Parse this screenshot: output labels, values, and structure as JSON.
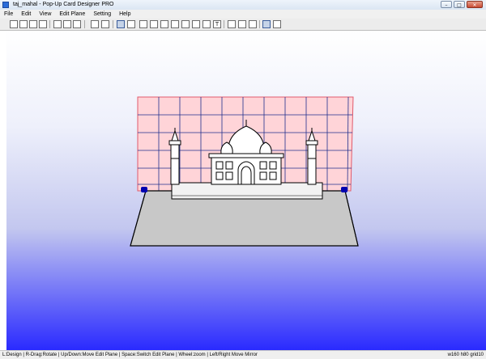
{
  "window": {
    "title": "taj_mahal - Pop-Up Card Designer PRO",
    "minimize_glyph": "–",
    "maximize_glyph": "□",
    "close_glyph": "✕"
  },
  "menu": [
    "File",
    "Edit",
    "View",
    "Edit Plane",
    "Setting",
    "Help"
  ],
  "toolbar": {
    "buttons": [
      "new-icon",
      "open-icon",
      "save-icon",
      "print-icon",
      "fit-icon",
      "cut-icon",
      "shape-icon",
      "layer-icon",
      "view-icon",
      "frame-icon",
      "rect-icon",
      "arc-icon",
      "tab-icon",
      "wedge-icon",
      "link-icon",
      "stop-icon",
      "text-icon",
      "mirror-icon",
      "zoom-in-icon",
      "zoom-out-icon",
      "grid-icon",
      "select-icon"
    ],
    "pressed": [
      "view-icon",
      "select-icon"
    ],
    "text_button_label": "T"
  },
  "status": {
    "hints": "L:Design | R-Drag:Rotate | Up/Down:Move Edit Plane | Space:Switch Edit Plane | Wheel:zoom | Left/Right Move Mirror",
    "dims": "w160 h80 grid10"
  },
  "colors": {
    "grid_fill": "#ffd4d8",
    "grid_line": "#1f2f8c",
    "base_fill": "#c8c8c8",
    "outline": "#000000",
    "hinge": "#0000b0"
  }
}
